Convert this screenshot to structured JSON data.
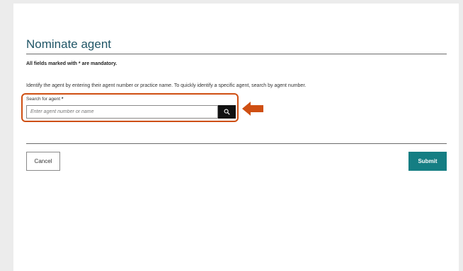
{
  "page": {
    "title": "Nominate agent",
    "mandatory_note": "All fields marked with * are mandatory.",
    "instructions": "Identify the agent by entering their agent number or practice name. To quickly identify a specific agent, search by agent number."
  },
  "search": {
    "label": "Search for agent",
    "required_marker": "*",
    "placeholder": "Enter agent number or name",
    "value": "",
    "icon": "search-icon"
  },
  "annotation": {
    "highlight_color": "#cf4f12",
    "arrow_icon": "left-arrow-icon"
  },
  "actions": {
    "cancel_label": "Cancel",
    "submit_label": "Submit"
  },
  "colors": {
    "title": "#1f5566",
    "primary": "#157e83",
    "search_button": "#111111"
  }
}
